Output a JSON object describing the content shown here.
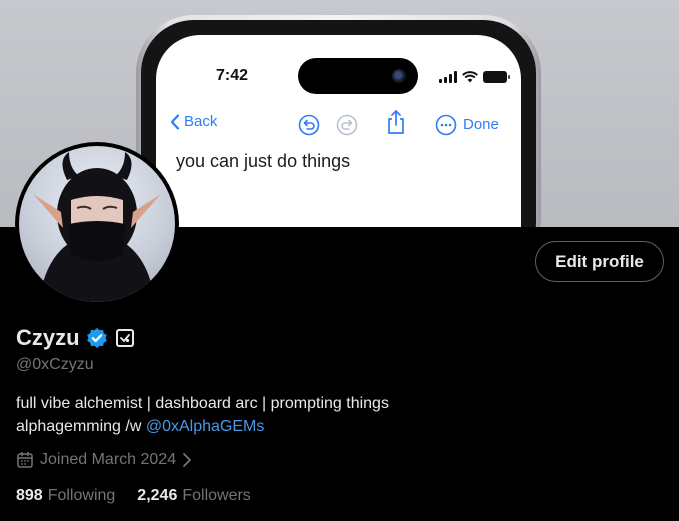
{
  "banner": {
    "phone": {
      "status_time": "7:42",
      "toolbar": {
        "back_label": "Back",
        "done_label": "Done"
      },
      "note_text": "you can just do things"
    }
  },
  "profile": {
    "edit_profile_label": "Edit profile",
    "display_name": "Czyzu",
    "handle": "@0xCzyzu",
    "bio_line1": "full vibe alchemist | dashboard arc | prompting things",
    "bio_line2_prefix": "alphagemming /w",
    "bio_mention": "@0xAlphaGEMs",
    "joined": "Joined March 2024",
    "following_count": "898",
    "following_label": "Following",
    "followers_count": "2,246",
    "followers_label": "Followers"
  },
  "icons": {
    "verified": "verified-badge-icon",
    "affiliate": "affiliate-badge-icon",
    "calendar": "calendar-icon",
    "chevron": "chevron-right-icon",
    "undo": "undo-icon",
    "redo": "redo-icon",
    "share": "share-icon",
    "more": "more-icon"
  },
  "colors": {
    "background": "#000000",
    "text_primary": "#e7e9ea",
    "text_secondary": "#71767b",
    "link": "#4a99e9",
    "verified": "#1d9bf0",
    "ios_blue": "#2f7cf6"
  }
}
